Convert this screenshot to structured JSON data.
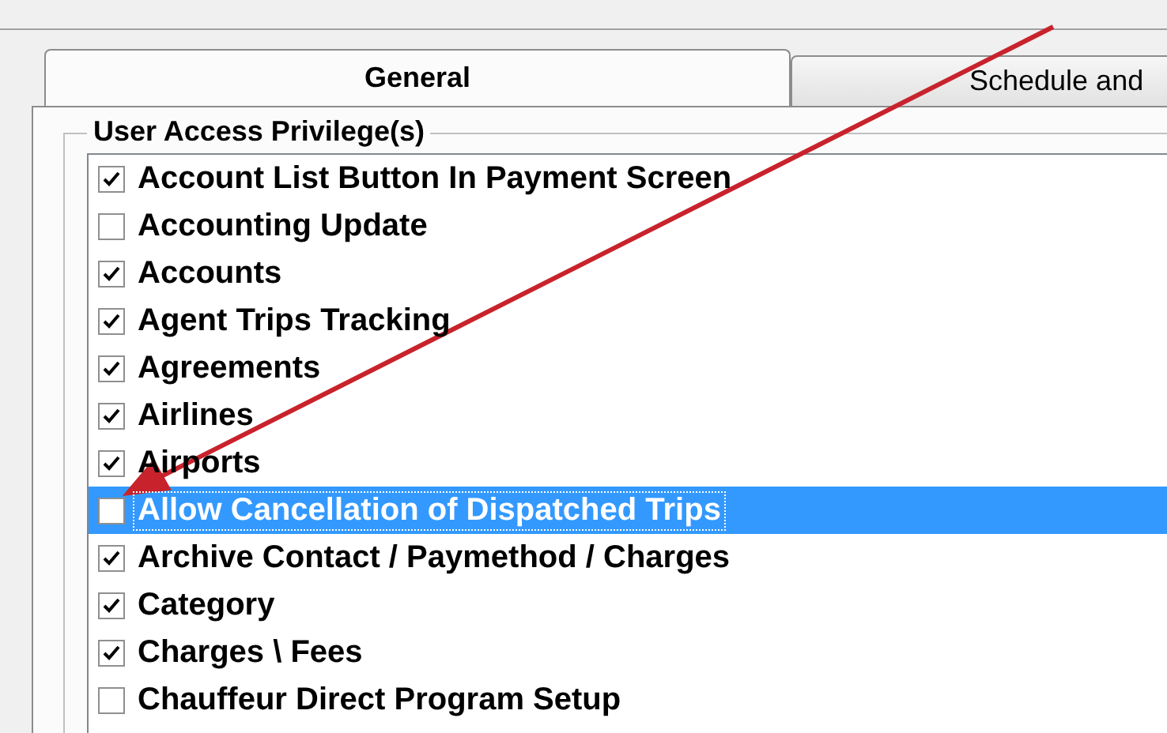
{
  "tabs": [
    {
      "label": "General",
      "selected": true
    },
    {
      "label": "Schedule and",
      "selected": false
    }
  ],
  "group": {
    "title": "User Access Privilege(s)"
  },
  "privileges": [
    {
      "label": "Account List Button In Payment Screen",
      "checked": true,
      "selected": false
    },
    {
      "label": "Accounting Update",
      "checked": false,
      "selected": false
    },
    {
      "label": "Accounts",
      "checked": true,
      "selected": false
    },
    {
      "label": "Agent Trips Tracking",
      "checked": true,
      "selected": false
    },
    {
      "label": "Agreements",
      "checked": true,
      "selected": false
    },
    {
      "label": "Airlines",
      "checked": true,
      "selected": false
    },
    {
      "label": "Airports",
      "checked": true,
      "selected": false
    },
    {
      "label": "Allow Cancellation of Dispatched Trips",
      "checked": false,
      "selected": true
    },
    {
      "label": "Archive Contact / Paymethod / Charges",
      "checked": true,
      "selected": false
    },
    {
      "label": "Category",
      "checked": true,
      "selected": false
    },
    {
      "label": "Charges \\ Fees",
      "checked": true,
      "selected": false
    },
    {
      "label": "Chauffeur Direct Program Setup",
      "checked": false,
      "selected": false
    }
  ]
}
